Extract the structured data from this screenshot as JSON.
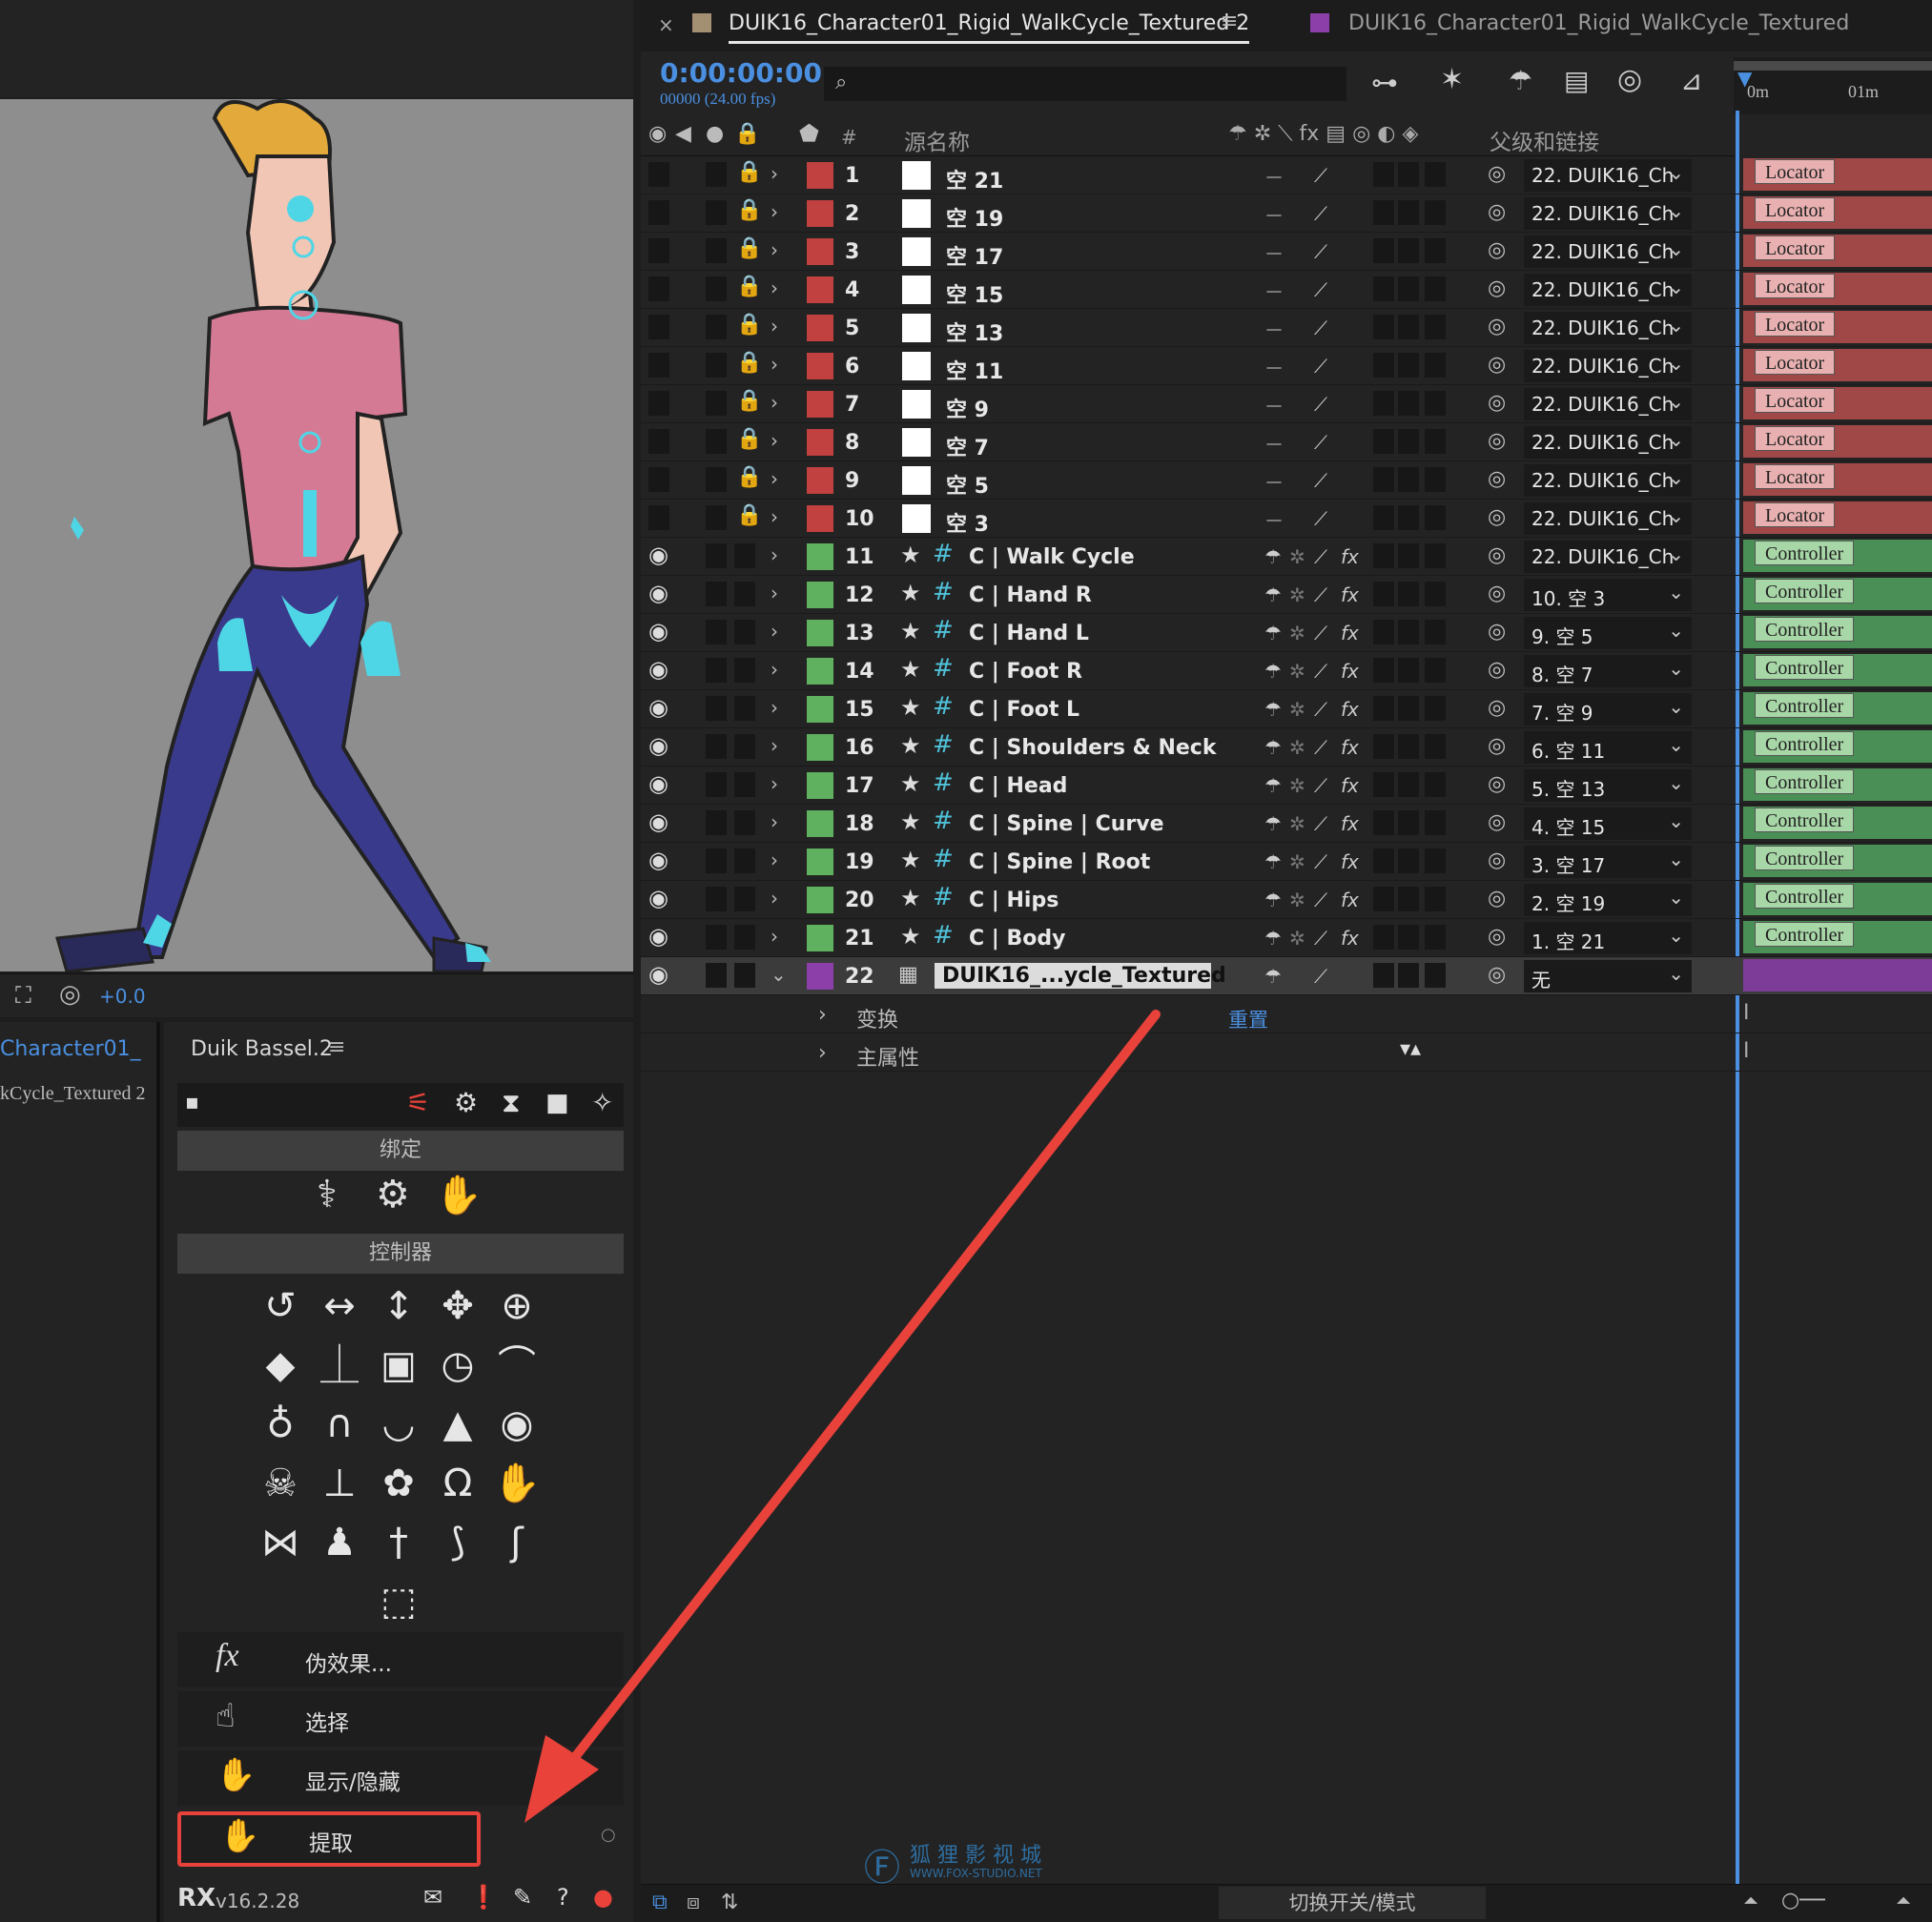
{
  "left_panel": {
    "viewer_exposure": "+0.0",
    "project_items": [
      "Character01_",
      "kCycle_Textured 2"
    ]
  },
  "duik": {
    "panel_title": "Duik Bassel.2",
    "section_rig": "绑定",
    "section_controllers": "控制器",
    "tools": [
      {
        "icon": "fx",
        "label": "伪效果..."
      },
      {
        "icon": "select-hand-icon",
        "label": "选择"
      },
      {
        "icon": "show-hide-icon",
        "label": "显示/隐藏"
      },
      {
        "icon": "extract-hand-icon",
        "label": "提取"
      }
    ],
    "version": "v16.2.28",
    "accent": "#e8423b"
  },
  "timeline": {
    "tabs": [
      {
        "label": "DUIK16_Character01_Rigid_WalkCycle_Textured 2",
        "color": "#a38f72",
        "active": true
      },
      {
        "label": "DUIK16_Character01_Rigid_WalkCycle_Textured",
        "color": "#8c3fa8",
        "active": false
      }
    ],
    "timecode": "0:00:00:00",
    "frames": "00000 (24.00 fps)",
    "ruler": [
      "0m",
      "01m"
    ],
    "headers": {
      "number": "#",
      "source_name": "源名称",
      "parent": "父级和链接"
    },
    "layers": [
      {
        "num": "1",
        "name": "空 21",
        "type": "null",
        "parent": "22. DUIK16_Ch",
        "tag": "Locator"
      },
      {
        "num": "2",
        "name": "空 19",
        "type": "null",
        "parent": "22. DUIK16_Ch",
        "tag": "Locator"
      },
      {
        "num": "3",
        "name": "空 17",
        "type": "null",
        "parent": "22. DUIK16_Ch",
        "tag": "Locator"
      },
      {
        "num": "4",
        "name": "空 15",
        "type": "null",
        "parent": "22. DUIK16_Ch",
        "tag": "Locator"
      },
      {
        "num": "5",
        "name": "空 13",
        "type": "null",
        "parent": "22. DUIK16_Ch",
        "tag": "Locator"
      },
      {
        "num": "6",
        "name": "空 11",
        "type": "null",
        "parent": "22. DUIK16_Ch",
        "tag": "Locator"
      },
      {
        "num": "7",
        "name": "空 9",
        "type": "null",
        "parent": "22. DUIK16_Ch",
        "tag": "Locator"
      },
      {
        "num": "8",
        "name": "空 7",
        "type": "null",
        "parent": "22. DUIK16_Ch",
        "tag": "Locator"
      },
      {
        "num": "9",
        "name": "空 5",
        "type": "null",
        "parent": "22. DUIK16_Ch",
        "tag": "Locator"
      },
      {
        "num": "10",
        "name": "空 3",
        "type": "null",
        "parent": "22. DUIK16_Ch",
        "tag": "Locator"
      },
      {
        "num": "11",
        "name": "C | Walk Cycle",
        "type": "ctrl",
        "parent": "22. DUIK16_Ch",
        "tag": "Controller"
      },
      {
        "num": "12",
        "name": "C | Hand R",
        "type": "ctrl",
        "parent": "10. 空 3",
        "tag": "Controller"
      },
      {
        "num": "13",
        "name": "C | Hand L",
        "type": "ctrl",
        "parent": "9. 空 5",
        "tag": "Controller"
      },
      {
        "num": "14",
        "name": "C | Foot R",
        "type": "ctrl",
        "parent": "8. 空 7",
        "tag": "Controller"
      },
      {
        "num": "15",
        "name": "C | Foot L",
        "type": "ctrl",
        "parent": "7. 空 9",
        "tag": "Controller"
      },
      {
        "num": "16",
        "name": "C | Shoulders & Neck",
        "type": "ctrl",
        "parent": "6. 空 11",
        "tag": "Controller"
      },
      {
        "num": "17",
        "name": "C | Head",
        "type": "ctrl",
        "parent": "5. 空 13",
        "tag": "Controller"
      },
      {
        "num": "18",
        "name": "C | Spine | Curve",
        "type": "ctrl",
        "parent": "4. 空 15",
        "tag": "Controller"
      },
      {
        "num": "19",
        "name": "C | Spine | Root",
        "type": "ctrl",
        "parent": "3. 空 17",
        "tag": "Controller"
      },
      {
        "num": "20",
        "name": "C | Hips",
        "type": "ctrl",
        "parent": "2. 空 19",
        "tag": "Controller"
      },
      {
        "num": "21",
        "name": "C | Body",
        "type": "ctrl",
        "parent": "1. 空 21",
        "tag": "Controller"
      },
      {
        "num": "22",
        "name": "DUIK16_...ycle_Textured",
        "type": "comp",
        "parent": "无",
        "tag": ""
      }
    ],
    "sub_rows": [
      {
        "label": "变换",
        "action": "重置"
      },
      {
        "label": "主属性",
        "action": ""
      }
    ],
    "footer_toggle": "切换开关/模式",
    "watermark_cn": "狐 狸 影 视 城",
    "watermark_url": "WWW.FOX-STUDIO.NET",
    "colors": {
      "null_label": "#c0413f",
      "ctrl_label": "#5fb05f",
      "comp_label": "#8c3fa8",
      "locator_bar": "#a04848",
      "controller_bar": "#4a8f55",
      "comp_bar": "#7d3c98",
      "timecode": "#4a8fe0"
    }
  }
}
